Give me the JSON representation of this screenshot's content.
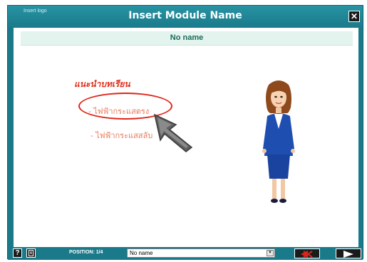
{
  "window": {
    "logo": "Insert logo",
    "title": "Insert Module Name",
    "close_label": "✕"
  },
  "content": {
    "subheader": "No name",
    "lesson_title": "แนะนำบทเรียน",
    "items": [
      "- ไฟฟ้ากระแสตรง",
      "- ไฟฟ้ากระแสสลับ"
    ]
  },
  "bottom": {
    "help_label": "?",
    "position_label": "POSITION: 1/4",
    "select_value": "No name"
  },
  "colors": {
    "frame": "#1a7a8a",
    "lesson_title": "#e0321f",
    "item": "#e87c5c",
    "highlight_ellipse": "#e0241a"
  }
}
